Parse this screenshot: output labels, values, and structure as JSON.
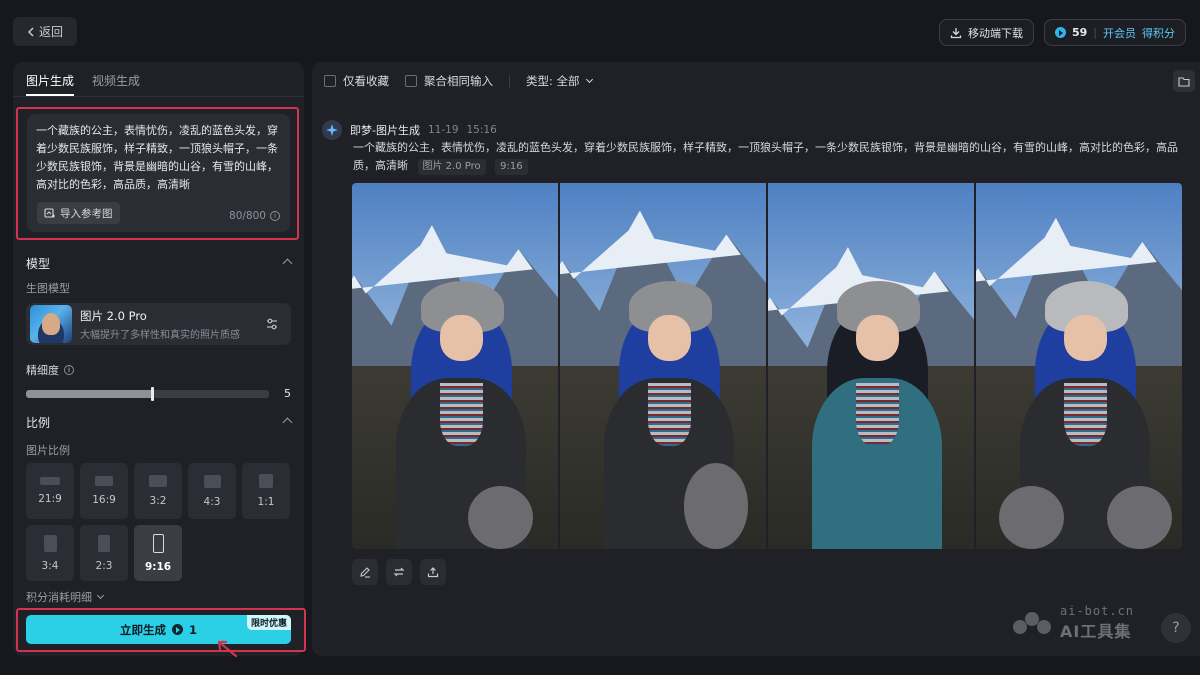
{
  "header": {
    "back_label": "返回",
    "mobile_download_label": "移动端下载",
    "credits": "59",
    "vip_label": "开会员",
    "earn_label": "得积分"
  },
  "left": {
    "tabs": [
      {
        "label": "图片生成",
        "active": true
      },
      {
        "label": "视频生成",
        "active": false
      }
    ],
    "prompt": {
      "text": "一个藏族的公主，表情忧伤，凌乱的蓝色头发，穿着少数民族服饰，样子精致，一顶狼头帽子，一条少数民族银饰，背景是幽暗的山谷，有雪的山峰，高对比的色彩，高品质，高清晰",
      "ref_button": "导入参考图",
      "counter": "80/800"
    },
    "model_section": {
      "title": "模型",
      "sublabel": "生图模型",
      "model_name": "图片 2.0 Pro",
      "model_desc": "大幅提升了多样性和真实的照片质感"
    },
    "detail": {
      "label": "精细度",
      "value": "5",
      "fill_fraction": 0.52
    },
    "ratio_section": {
      "title": "比例",
      "sublabel": "图片比例",
      "options": [
        {
          "label": "21:9",
          "active": false
        },
        {
          "label": "16:9",
          "active": false
        },
        {
          "label": "3:2",
          "active": false
        },
        {
          "label": "4:3",
          "active": false
        },
        {
          "label": "1:1",
          "active": false
        },
        {
          "label": "3:4",
          "active": false
        },
        {
          "label": "2:3",
          "active": false
        },
        {
          "label": "9:16",
          "active": true
        }
      ]
    },
    "cost_label": "积分消耗明细",
    "generate": {
      "label": "立即生成",
      "cost": "1",
      "promo": "限时优惠"
    }
  },
  "main": {
    "toolbar": {
      "fav_only": "仅看收藏",
      "aggregate": "聚合相同输入",
      "type_label": "类型: 全部"
    },
    "feed": {
      "source": "即梦-图片生成",
      "date": "11-19",
      "time": "15:16",
      "prompt": "一个藏族的公主，表情忧伤，凌乱的蓝色头发，穿着少数民族服饰，样子精致，一顶狼头帽子，一条少数民族银饰，背景是幽暗的山谷，有雪的山峰，高对比的色彩，高品质，高清晰",
      "model_tag": "图片 2.0 Pro",
      "ratio_tag": "9:16"
    }
  },
  "watermark": {
    "domain": "ai-bot.cn",
    "name": "AI工具集"
  },
  "help_label": "?"
}
